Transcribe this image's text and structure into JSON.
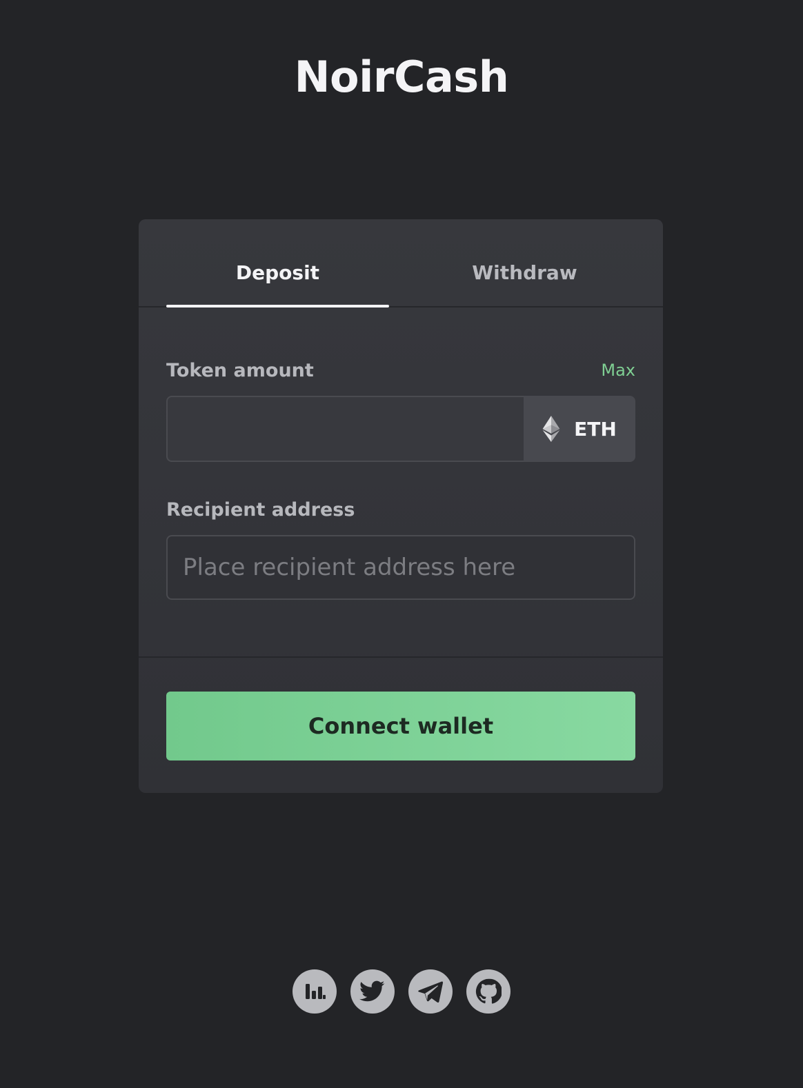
{
  "header": {
    "title": "NoirCash"
  },
  "tabs": [
    {
      "label": "Deposit",
      "active": true
    },
    {
      "label": "Withdraw",
      "active": false
    }
  ],
  "form": {
    "token_amount_label": "Token amount",
    "max_label": "Max",
    "amount_value": "",
    "token_symbol": "ETH",
    "token_icon": "ethereum-icon",
    "recipient_label": "Recipient address",
    "recipient_placeholder": "Place recipient address here",
    "recipient_value": ""
  },
  "actions": {
    "connect_label": "Connect wallet"
  },
  "footer": {
    "social_icons": [
      "stats-icon",
      "twitter-icon",
      "telegram-icon",
      "github-icon"
    ]
  },
  "colors": {
    "background": "#232427",
    "card": "#35363b",
    "accent_green": "#7fcf93",
    "icon_gray": "#b9babe"
  }
}
